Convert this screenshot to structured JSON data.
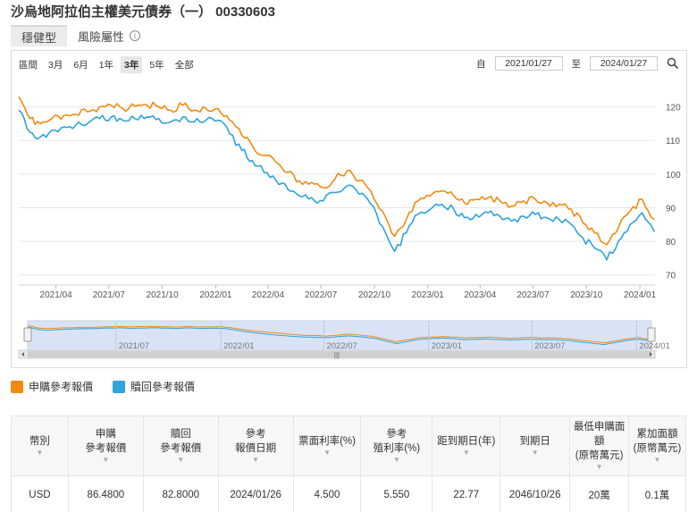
{
  "title": "沙烏地阿拉伯主權美元債券（一） 00330603",
  "tabs": [
    {
      "label": "穩健型",
      "active": true
    },
    {
      "label": "風險屬性",
      "active": false
    }
  ],
  "range_bar": {
    "label": "區間",
    "buttons": [
      "3月",
      "6月",
      "1年",
      "3年",
      "5年",
      "全部"
    ],
    "active": "3年"
  },
  "date_range": {
    "from_label": "自",
    "from": "2021/01/27",
    "to_label": "至",
    "to": "2024/01/27",
    "search_icon": "search-icon"
  },
  "colors": {
    "buy": "#f28a10",
    "redeem": "#2ea3dc",
    "navigator_fill": "#d9e3f5"
  },
  "chart_data": {
    "type": "line",
    "x_tick_labels": [
      "2021/04",
      "2021/07",
      "2021/10",
      "2022/01",
      "2022/04",
      "2022/07",
      "2022/10",
      "2023/01",
      "2023/04",
      "2023/07",
      "2023/10",
      "2024/01"
    ],
    "y_tick_labels": [
      "120",
      "110",
      "100",
      "90",
      "80",
      "70"
    ],
    "ylim": [
      67,
      126
    ],
    "xlim": [
      "2021/01/27",
      "2024/01/27"
    ],
    "grid": true,
    "legend_position": "bottom-left",
    "x": [
      "2021/01/27",
      "2021/02/15",
      "2021/03/05",
      "2021/03/25",
      "2021/04/15",
      "2021/05/05",
      "2021/05/25",
      "2021/06/15",
      "2021/07/05",
      "2021/07/25",
      "2021/08/15",
      "2021/09/05",
      "2021/09/25",
      "2021/10/15",
      "2021/11/05",
      "2021/11/25",
      "2021/12/15",
      "2022/01/05",
      "2022/01/25",
      "2022/02/15",
      "2022/03/05",
      "2022/03/25",
      "2022/04/15",
      "2022/05/05",
      "2022/05/25",
      "2022/06/15",
      "2022/07/05",
      "2022/07/25",
      "2022/08/15",
      "2022/09/05",
      "2022/09/25",
      "2022/10/15",
      "2022/11/05",
      "2022/11/25",
      "2022/12/15",
      "2023/01/05",
      "2023/01/25",
      "2023/02/15",
      "2023/03/05",
      "2023/03/25",
      "2023/04/15",
      "2023/05/05",
      "2023/05/25",
      "2023/06/15",
      "2023/07/05",
      "2023/07/25",
      "2023/08/15",
      "2023/09/05",
      "2023/09/25",
      "2023/10/15",
      "2023/11/05",
      "2023/11/25",
      "2023/12/15",
      "2024/01/05",
      "2024/01/26"
    ],
    "series": [
      {
        "name": "申購參考報價",
        "color": "#f28a10",
        "values": [
          123.0,
          116.5,
          115.0,
          116.5,
          117.5,
          117.8,
          118.5,
          120.0,
          120.5,
          119.5,
          120.2,
          120.5,
          120.0,
          119.0,
          120.5,
          119.0,
          119.5,
          119.5,
          116.0,
          111.5,
          108.5,
          105.5,
          103.5,
          100.5,
          98.0,
          97.5,
          96.0,
          98.5,
          101.0,
          98.0,
          95.0,
          89.0,
          81.5,
          86.5,
          92.0,
          93.5,
          95.0,
          93.5,
          91.5,
          92.5,
          93.0,
          92.0,
          90.5,
          92.0,
          92.5,
          91.5,
          91.0,
          89.5,
          85.5,
          82.5,
          79.0,
          84.0,
          89.0,
          92.5,
          86.5
        ]
      },
      {
        "name": "贖回參考報價",
        "color": "#2ea3dc",
        "values": [
          119.0,
          112.5,
          111.0,
          113.0,
          114.0,
          114.5,
          115.0,
          116.5,
          117.0,
          116.0,
          116.5,
          117.0,
          116.5,
          115.5,
          117.0,
          115.5,
          116.0,
          116.0,
          112.0,
          107.0,
          104.0,
          100.5,
          98.0,
          95.5,
          93.5,
          93.0,
          92.0,
          94.5,
          96.5,
          94.0,
          91.0,
          84.5,
          77.0,
          82.5,
          88.0,
          89.5,
          91.0,
          89.5,
          87.0,
          88.0,
          88.5,
          87.5,
          86.0,
          87.5,
          88.0,
          87.0,
          86.5,
          85.0,
          81.0,
          78.0,
          74.5,
          80.0,
          85.0,
          88.5,
          82.8
        ]
      }
    ]
  },
  "navigator": {
    "tick_labels": [
      "2021/07",
      "2022/01",
      "2022/07",
      "2023/01",
      "2023/07",
      "2024/01"
    ]
  },
  "legend": {
    "buy_label": "申購參考報價",
    "redeem_label": "贖回參考報價"
  },
  "table": {
    "headers": [
      [
        "幣別"
      ],
      [
        "申購",
        "參考報價"
      ],
      [
        "贖回",
        "參考報價"
      ],
      [
        "參考",
        "報價日期"
      ],
      [
        "票面利率(%)"
      ],
      [
        "參考",
        "殖利率(%)"
      ],
      [
        "距到期日(年)"
      ],
      [
        "到期日"
      ],
      [
        "最低申購面額",
        "(原幣萬元)"
      ],
      [
        "累加面額",
        "(原幣萬元)"
      ]
    ],
    "sort_glyph": "▼",
    "rows": [
      [
        "USD",
        "86.4800",
        "82.8000",
        "2024/01/26",
        "4.500",
        "5.550",
        "22.77",
        "2046/10/26",
        "20萬",
        "0.1萬"
      ]
    ]
  }
}
